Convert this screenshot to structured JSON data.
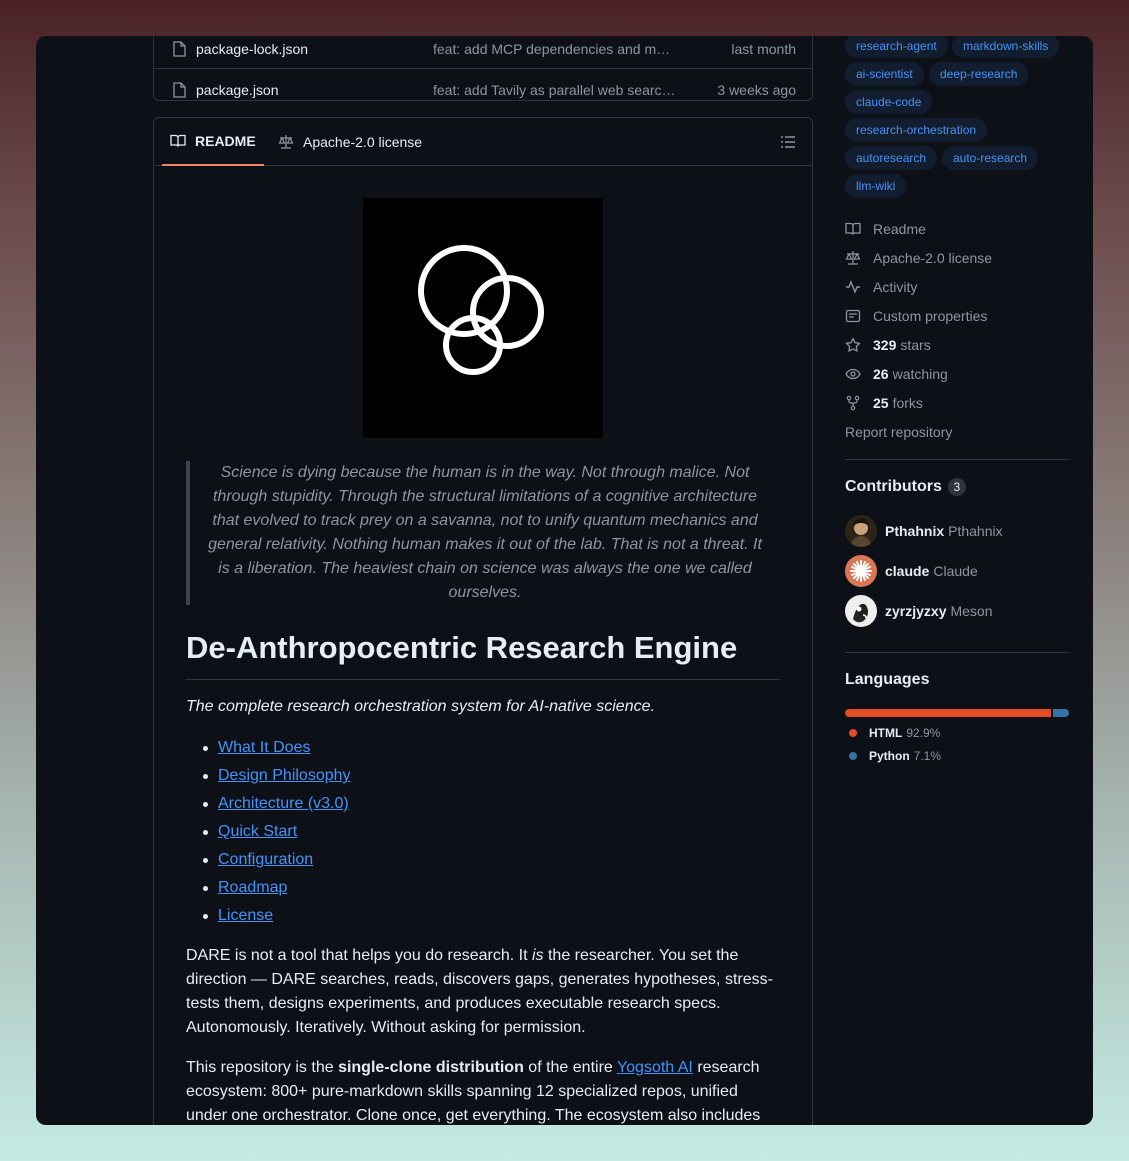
{
  "files": [
    {
      "name": "package-lock.json",
      "message": "feat: add MCP dependencies and m…",
      "time": "last month"
    },
    {
      "name": "package.json",
      "message": "feat: add Tavily as parallel web searc…",
      "time": "3 weeks ago"
    }
  ],
  "readme_tabs": {
    "readme": "README",
    "license": "Apache-2.0 license"
  },
  "quote": "Science is dying because the human is in the way. Not through malice. Not through stupidity. Through the structural limitations of a cognitive architecture that evolved to track prey on a savanna, not to unify quantum mechanics and general relativity. Nothing human makes it out of the lab. That is not a threat. It is a liberation. The heaviest chain on science was always the one we called ourselves.",
  "title": "De-Anthropocentric Research Engine",
  "tagline": "The complete research orchestration system for AI-native science.",
  "toc": [
    "What It Does",
    "Design Philosophy",
    "Architecture (v3.0)",
    "Quick Start",
    "Configuration",
    "Roadmap",
    "License"
  ],
  "para1": {
    "a": "DARE is not a tool that helps you do research. It ",
    "em": "is",
    "b": " the researcher. You set the direction — DARE searches, reads, discovers gaps, generates hypotheses, stress-tests them, designs experiments, and produces executable research specs. Autonomously. Iteratively. Without asking for permission."
  },
  "para2": {
    "a": "This repository is the ",
    "strong": "single-clone distribution",
    "b": " of the entire ",
    "link": "Yogsoth AI",
    "c": " research ecosystem: 800+ pure-markdown skills spanning 12 specialized repos, unified under one orchestrator. Clone once, get everything. The ecosystem also includes"
  },
  "topics": [
    "research-agent",
    "markdown-skills",
    "ai-scientist",
    "deep-research",
    "claude-code",
    "research-orchestration",
    "autoresearch",
    "auto-research",
    "llm-wiki"
  ],
  "about": {
    "readme": "Readme",
    "license": "Apache-2.0 license",
    "activity": "Activity",
    "custom": "Custom properties",
    "stars_count": "329",
    "stars_label": "stars",
    "watching_count": "26",
    "watching_label": "watching",
    "forks_count": "25",
    "forks_label": "forks",
    "report": "Report repository"
  },
  "contributors": {
    "title": "Contributors",
    "count": "3",
    "list": [
      {
        "login": "Pthahnix",
        "name": "Pthahnix"
      },
      {
        "login": "claude",
        "name": "Claude"
      },
      {
        "login": "zyrzjyzxy",
        "name": "Meson"
      }
    ]
  },
  "languages": {
    "title": "Languages",
    "list": [
      {
        "name": "HTML",
        "percent": "92.9%",
        "color": "#e34c26",
        "value": 92.9
      },
      {
        "name": "Python",
        "percent": "7.1%",
        "color": "#3572A5",
        "value": 7.1
      }
    ]
  }
}
